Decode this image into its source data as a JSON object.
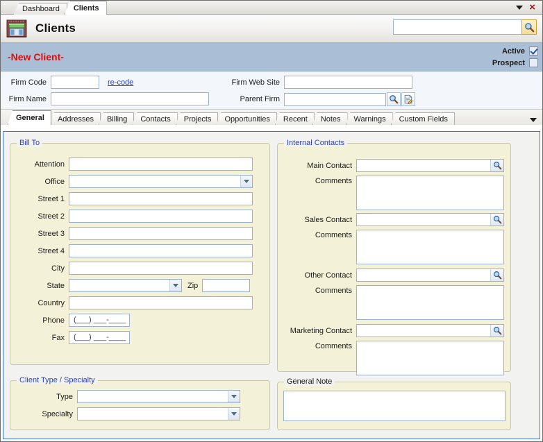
{
  "window": {
    "tabs": [
      {
        "label": "Dashboard",
        "active": false
      },
      {
        "label": "Clients",
        "active": true
      }
    ],
    "menu_caret": "chevron-down-icon",
    "close_label": "×"
  },
  "header": {
    "icon": "storefront-icon",
    "title": "Clients",
    "search": {
      "value": "",
      "placeholder": "",
      "button_icon": "search-icon"
    }
  },
  "status_band": {
    "record_title": "-New Client-",
    "flags": [
      {
        "label": "Active",
        "checked": true
      },
      {
        "label": "Prospect",
        "checked": false
      }
    ]
  },
  "firm": {
    "firm_code": {
      "label": "Firm Code",
      "value": ""
    },
    "recode_link": "re-code",
    "firm_name": {
      "label": "Firm Name",
      "value": ""
    },
    "firm_web_site": {
      "label": "Firm Web Site",
      "value": ""
    },
    "parent_firm": {
      "label": "Parent Firm",
      "value": "",
      "lookup_icon": "search-icon",
      "edit_icon": "edit-document-icon"
    }
  },
  "tabs": {
    "items": [
      {
        "label": "General",
        "active": true
      },
      {
        "label": "Addresses",
        "active": false
      },
      {
        "label": "Billing",
        "active": false
      },
      {
        "label": "Contacts",
        "active": false
      },
      {
        "label": "Projects",
        "active": false
      },
      {
        "label": "Opportunities",
        "active": false
      },
      {
        "label": "Recent",
        "active": false
      },
      {
        "label": "Notes",
        "active": false
      },
      {
        "label": "Warnings",
        "active": false
      },
      {
        "label": "Custom Fields",
        "active": false
      }
    ],
    "overflow_icon": "chevron-down-icon"
  },
  "bill_to": {
    "legend": "Bill To",
    "attention": {
      "label": "Attention",
      "value": ""
    },
    "office": {
      "label": "Office",
      "value": ""
    },
    "street1": {
      "label": "Street 1",
      "value": ""
    },
    "street2": {
      "label": "Street 2",
      "value": ""
    },
    "street3": {
      "label": "Street 3",
      "value": ""
    },
    "street4": {
      "label": "Street 4",
      "value": ""
    },
    "city": {
      "label": "City",
      "value": ""
    },
    "state": {
      "label": "State",
      "value": ""
    },
    "zip": {
      "label": "Zip",
      "value": ""
    },
    "country": {
      "label": "Country",
      "value": ""
    },
    "phone": {
      "label": "Phone",
      "mask": "(___) ___-____"
    },
    "fax": {
      "label": "Fax",
      "mask": "(___) ___-____"
    }
  },
  "internal_contacts": {
    "legend": "Internal Contacts",
    "main_contact": {
      "label": "Main Contact",
      "value": "",
      "lookup_icon": "search-icon"
    },
    "main_comments": {
      "label": "Comments",
      "value": ""
    },
    "sales_contact": {
      "label": "Sales Contact",
      "value": "",
      "lookup_icon": "search-icon"
    },
    "sales_comments": {
      "label": "Comments",
      "value": ""
    },
    "other_contact": {
      "label": "Other Contact",
      "value": "",
      "lookup_icon": "search-icon"
    },
    "other_comments": {
      "label": "Comments",
      "value": ""
    },
    "marketing_contact": {
      "label": "Marketing Contact",
      "value": "",
      "lookup_icon": "search-icon"
    },
    "marketing_comments": {
      "label": "Comments",
      "value": ""
    }
  },
  "client_type": {
    "legend": "Client Type / Specialty",
    "type": {
      "label": "Type",
      "value": ""
    },
    "specialty": {
      "label": "Specialty",
      "value": ""
    }
  },
  "general_note": {
    "legend": "General Note",
    "value": ""
  },
  "colors": {
    "band_blue": "#aabfd6",
    "record_red": "#d81010",
    "legend_blue": "#2b3fbf",
    "group_bg": "#f3f1d8",
    "panel_border": "#3c76c8",
    "link_blue": "#2b3fbf"
  }
}
